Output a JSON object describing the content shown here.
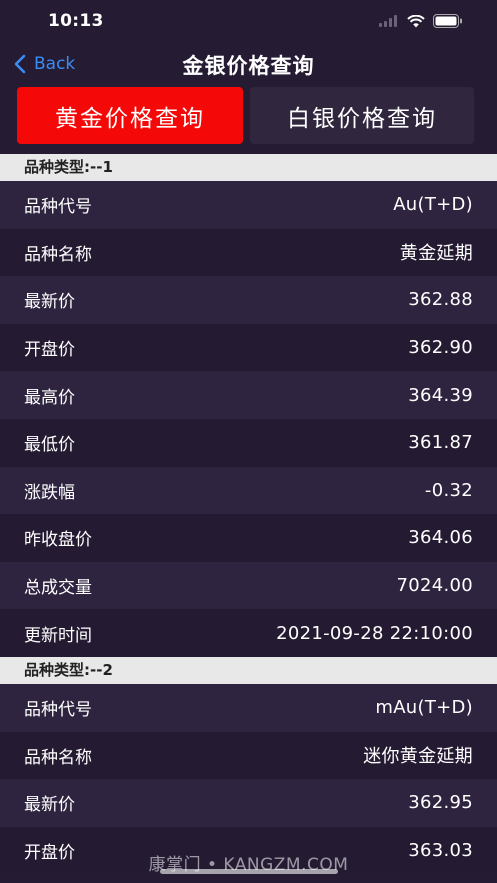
{
  "status_bar": {
    "time": "10:13"
  },
  "nav": {
    "back_label": "Back",
    "title": "金银价格查询"
  },
  "tabs": [
    {
      "label": "黄金价格查询",
      "active": true,
      "color": "#f50808"
    },
    {
      "label": "白银价格查询",
      "active": false,
      "color": "#30273f"
    }
  ],
  "sections": [
    {
      "header": "品种类型:--1",
      "rows": [
        {
          "label": "品种代号",
          "value": "Au(T+D)"
        },
        {
          "label": "品种名称",
          "value": "黄金延期"
        },
        {
          "label": "最新价",
          "value": "362.88"
        },
        {
          "label": "开盘价",
          "value": "362.90"
        },
        {
          "label": "最高价",
          "value": "364.39"
        },
        {
          "label": "最低价",
          "value": "361.87"
        },
        {
          "label": "涨跌幅",
          "value": "-0.32"
        },
        {
          "label": "昨收盘价",
          "value": "364.06"
        },
        {
          "label": "总成交量",
          "value": "7024.00"
        },
        {
          "label": "更新时间",
          "value": "2021-09-28 22:10:00"
        }
      ]
    },
    {
      "header": "品种类型:--2",
      "rows": [
        {
          "label": "品种代号",
          "value": "mAu(T+D)"
        },
        {
          "label": "品种名称",
          "value": "迷你黄金延期"
        },
        {
          "label": "最新价",
          "value": "362.95"
        },
        {
          "label": "开盘价",
          "value": "363.03"
        }
      ]
    }
  ],
  "watermark": "康掌门 • KANGZM.COM"
}
